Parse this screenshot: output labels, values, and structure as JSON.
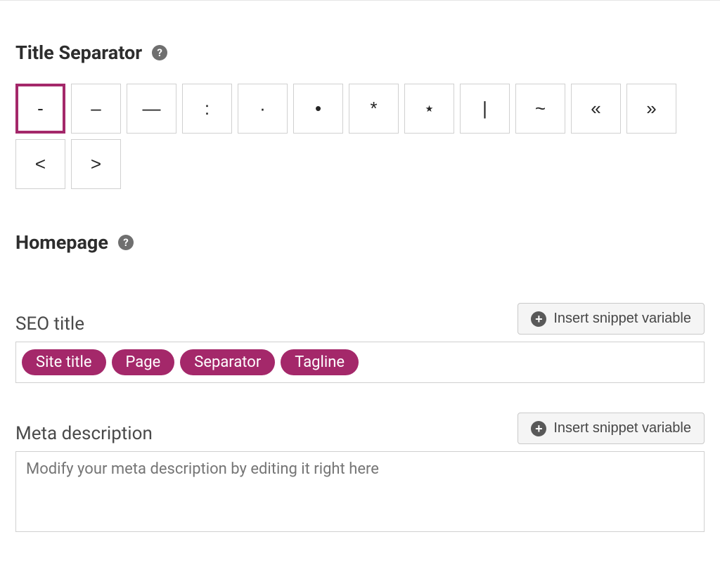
{
  "title_separator": {
    "heading": "Title Separator",
    "options": [
      "-",
      "–",
      "—",
      ":",
      "·",
      "•",
      "*",
      "⋆",
      "|",
      "~",
      "«",
      "»",
      "<",
      ">"
    ],
    "selected_index": 0
  },
  "homepage": {
    "heading": "Homepage"
  },
  "seo_title": {
    "label": "SEO title",
    "insert_button": "Insert snippet variable",
    "pills": [
      "Site title",
      "Page",
      "Separator",
      "Tagline"
    ]
  },
  "meta_description": {
    "label": "Meta description",
    "insert_button": "Insert snippet variable",
    "placeholder": "Modify your meta description by editing it right here"
  }
}
